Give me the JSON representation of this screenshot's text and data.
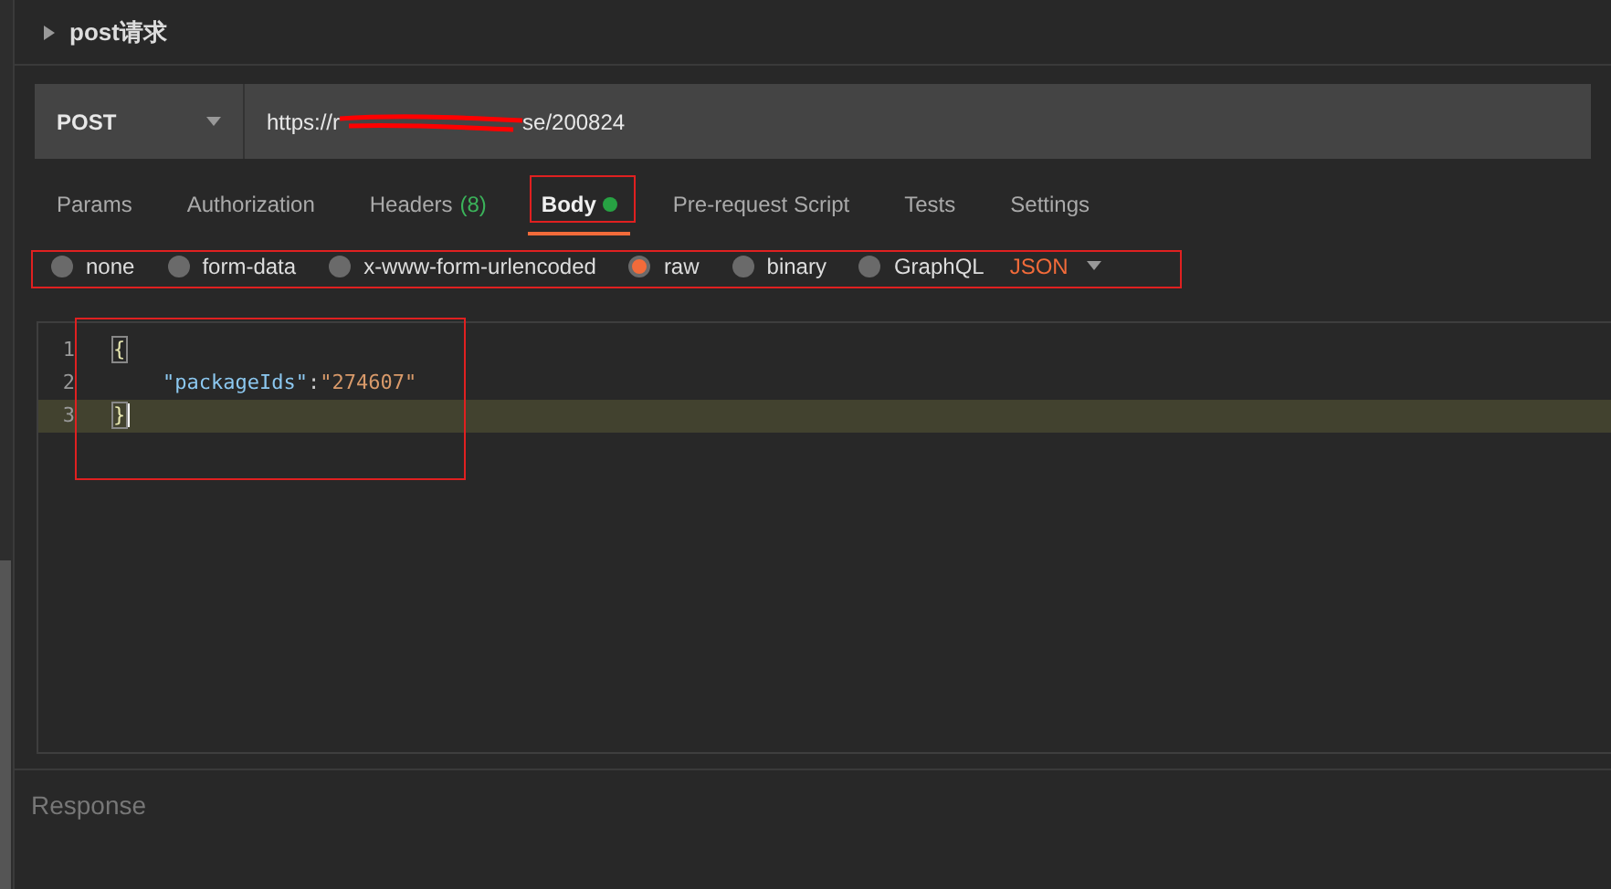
{
  "request": {
    "title": "post请求",
    "method": "POST",
    "url_start": "https://r",
    "url_end": "se/200824"
  },
  "tabs": [
    {
      "label": "Params",
      "selected": false
    },
    {
      "label": "Authorization",
      "selected": false
    },
    {
      "label": "Headers",
      "count": "(8)",
      "selected": false
    },
    {
      "label": "Body",
      "selected": true,
      "dot": true
    },
    {
      "label": "Pre-request Script",
      "selected": false
    },
    {
      "label": "Tests",
      "selected": false
    },
    {
      "label": "Settings",
      "selected": false
    }
  ],
  "body_types": [
    {
      "label": "none",
      "selected": false
    },
    {
      "label": "form-data",
      "selected": false
    },
    {
      "label": "x-www-form-urlencoded",
      "selected": false
    },
    {
      "label": "raw",
      "selected": true
    },
    {
      "label": "binary",
      "selected": false
    },
    {
      "label": "GraphQL",
      "selected": false
    }
  ],
  "format": "JSON",
  "editor": {
    "lines": [
      {
        "number": "1",
        "tokens": [
          {
            "kind": "brace",
            "text": "{"
          }
        ],
        "current": false
      },
      {
        "number": "2",
        "tokens": [
          {
            "kind": "key",
            "text": "\"packageIds\""
          },
          {
            "kind": "punct",
            "text": ":"
          },
          {
            "kind": "string",
            "text": "\"274607\""
          }
        ],
        "current": false
      },
      {
        "number": "3",
        "tokens": [
          {
            "kind": "brace",
            "text": "}"
          }
        ],
        "current": true
      }
    ]
  },
  "response": {
    "label": "Response"
  }
}
